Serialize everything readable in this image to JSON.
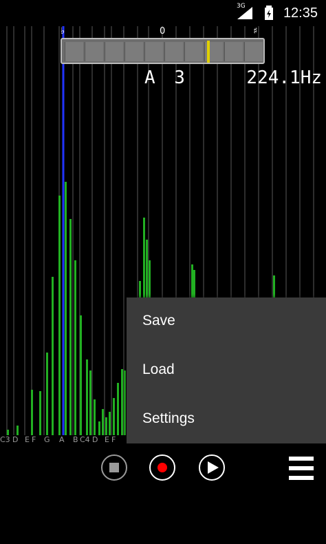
{
  "status": {
    "time": "12:35",
    "network_label": "3G",
    "icons": [
      "signal-icon",
      "battery-icon"
    ]
  },
  "tuner": {
    "flat_symbol": "♭",
    "center_symbol": "0",
    "sharp_symbol": "♯",
    "note": "A 3",
    "frequency": "224.1Hz"
  },
  "note_labels": [
    "C3",
    "D",
    "E",
    "F",
    "G",
    "A",
    "B",
    "C4",
    "D",
    "E",
    "F"
  ],
  "menu": {
    "items": [
      {
        "label": "Save"
      },
      {
        "label": "Load"
      },
      {
        "label": "Settings"
      }
    ]
  },
  "controls": {
    "stop_icon": "stop-icon",
    "record_icon": "record-icon",
    "play_icon": "play-icon",
    "menu_icon": "hamburger-menu-icon"
  },
  "colors": {
    "spectrum_bar": "#22b022",
    "highlight_line": "#2233ff",
    "meter_indicator": "#e0d000",
    "record_dot": "#ff0000",
    "menu_bg": "#3a3a3a"
  }
}
